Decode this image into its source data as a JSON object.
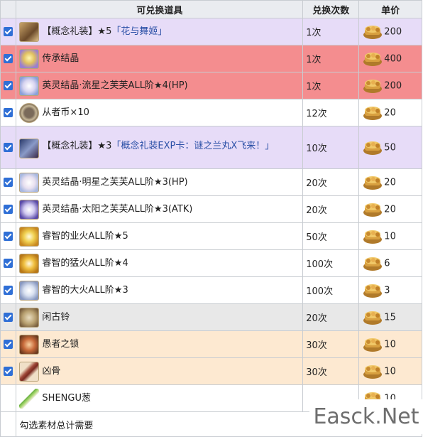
{
  "header": {
    "item": "可兑换道具",
    "count": "兑换次数",
    "price": "单价"
  },
  "colors": {
    "purple": "#e7dcf8",
    "red": "#f48d8f",
    "gray": "#e8e8e8",
    "peach": "#fde9d1",
    "checkbox": "#2f6fd6",
    "link": "#2a4fa6"
  },
  "rows": [
    {
      "checked": true,
      "icon": "craft-essence-icon",
      "name_prefix": "【概念礼装】★5",
      "name_link": "「花与舞姬」",
      "count": "1次",
      "price": "200"
    },
    {
      "checked": true,
      "icon": "inheritance-crystal-icon",
      "name": "传承结晶",
      "count": "1次",
      "price": "400"
    },
    {
      "checked": true,
      "icon": "fou-card-icon",
      "name": "英灵结晶·流星之芙芙ALL阶★4(HP)",
      "count": "1次",
      "price": "200"
    },
    {
      "checked": true,
      "icon": "servant-coin-icon",
      "name": "从者币×10",
      "count": "12次",
      "price": "20"
    },
    {
      "checked": true,
      "icon": "craft-essence-exp-icon",
      "name_prefix": "【概念礼装】★3",
      "name_link": "「概念礼装EXP卡：谜之兰丸X飞来！」",
      "count": "10次",
      "price": "50"
    },
    {
      "checked": true,
      "icon": "fou-card-icon",
      "name": "英灵结晶·明星之芙芙ALL阶★3(HP)",
      "count": "20次",
      "price": "20"
    },
    {
      "checked": true,
      "icon": "fou-card-icon",
      "name": "英灵结晶·太阳之芙芙ALL阶★3(ATK)",
      "count": "20次",
      "price": "20"
    },
    {
      "checked": true,
      "icon": "ember-icon",
      "name": "睿智的业火ALL阶★5",
      "count": "50次",
      "price": "10"
    },
    {
      "checked": true,
      "icon": "ember-icon",
      "name": "睿智的猛火ALL阶★4",
      "count": "100次",
      "price": "6"
    },
    {
      "checked": true,
      "icon": "ember-icon",
      "name": "睿智的大火ALL阶★3",
      "count": "100次",
      "price": "3"
    },
    {
      "checked": true,
      "icon": "bell-icon",
      "name": "闲古铃",
      "count": "20次",
      "price": "15"
    },
    {
      "checked": true,
      "icon": "fool-chain-icon",
      "name": "愚者之锁",
      "count": "30次",
      "price": "10"
    },
    {
      "checked": true,
      "icon": "evil-bone-icon",
      "name": "凶骨",
      "count": "30次",
      "price": "10"
    },
    {
      "checked": false,
      "icon": "green-onion-icon",
      "name": "SHENGU葱",
      "count": "",
      "price": "10"
    }
  ],
  "footer": {
    "label": "勾选素材总计需要"
  },
  "watermark": "Easck.Net"
}
